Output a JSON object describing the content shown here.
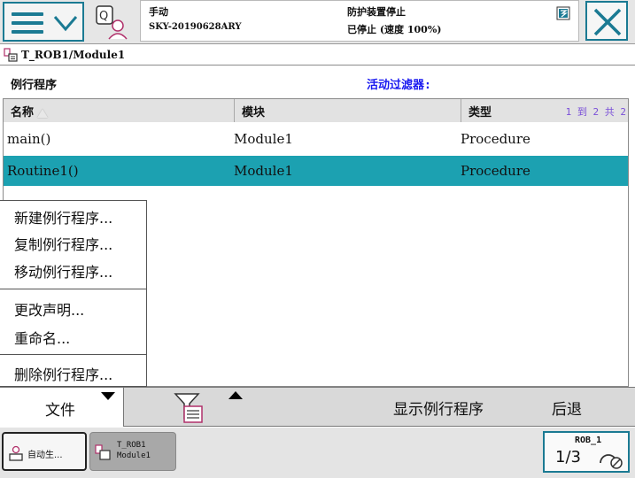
{
  "status": {
    "mode": "手动",
    "controller": "SKY-20190628ARY",
    "safety": "防护装置停止",
    "run_state": "已停止 (速度 100%)"
  },
  "path": "T_ROB1/Module1",
  "section": {
    "title": "例行程序",
    "filter_label": "活动过滤器:"
  },
  "table": {
    "columns": [
      "名称",
      "模块",
      "类型"
    ],
    "page_info": "1 到 2 共 2",
    "rows": [
      {
        "name": "main()",
        "module": "Module1",
        "type": "Procedure"
      },
      {
        "name": "Routine1()",
        "module": "Module1",
        "type": "Procedure"
      }
    ]
  },
  "context_menu": {
    "items": [
      "新建例行程序...",
      "复制例行程序...",
      "移动例行程序...",
      "更改声明...",
      "重命名...",
      "删除例行程序..."
    ]
  },
  "toolbar": {
    "file": "文件",
    "show_routine": "显示例行程序",
    "back": "后退"
  },
  "taskbar": {
    "task1": "自动生...",
    "task2_line1": "T_ROB1",
    "task2_line2": "Module1",
    "quickset_robot": "ROB_1",
    "quickset_fraction": "1/3"
  },
  "colors": {
    "accent": "#1b7a93",
    "selected_row": "#1ca1b1",
    "filter_text": "#1a1af0",
    "page_info": "#7a4fd8"
  }
}
